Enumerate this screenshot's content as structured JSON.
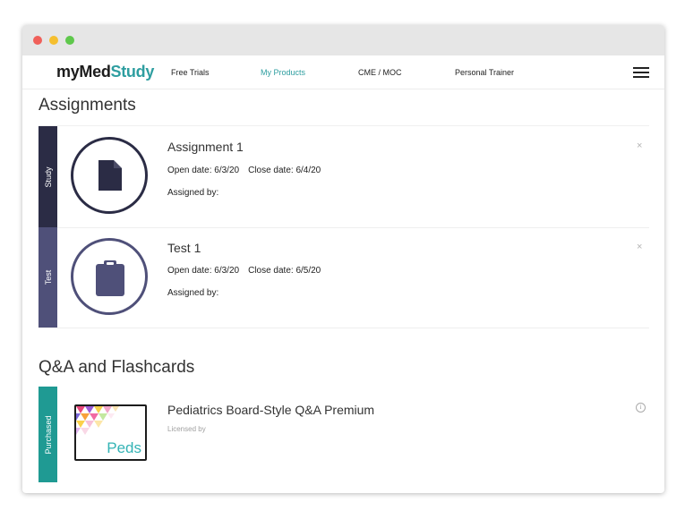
{
  "window": {
    "controls": [
      "close",
      "minimize",
      "maximize"
    ]
  },
  "nav": {
    "logo_prefix": "my",
    "logo_med": "Med",
    "logo_study": "Study",
    "links": [
      "Free Trials",
      "My Products",
      "CME / MOC",
      "Personal Trainer"
    ],
    "active_link": "My Products",
    "menu_icon": "hamburger-menu-icon"
  },
  "assignments": {
    "title": "Assignments",
    "items": [
      {
        "tag": "Study",
        "icon": "document-icon",
        "title": "Assignment 1",
        "open_label": "Open date: 6/3/20",
        "close_label": "Close date: 6/4/20",
        "assigned_label": "Assigned by:",
        "dismiss": "×"
      },
      {
        "tag": "Test",
        "icon": "clipboard-icon",
        "title": "Test 1",
        "open_label": "Open date: 6/3/20",
        "close_label": "Close date: 6/5/20",
        "assigned_label": "Assigned by:",
        "dismiss": "×"
      }
    ]
  },
  "qa": {
    "title": "Q&A and Flashcards",
    "items": [
      {
        "tag": "Purchased",
        "thumb_text": "Peds",
        "title": "Pediatrics Board-Style Q&A Premium",
        "subtitle": "Licensed by",
        "info": "i"
      }
    ]
  },
  "colors": {
    "accent": "#2e9ea0",
    "study_tag": "#2b2c45",
    "test_tag": "#4f5079",
    "purchased_tag": "#1f9a93"
  }
}
